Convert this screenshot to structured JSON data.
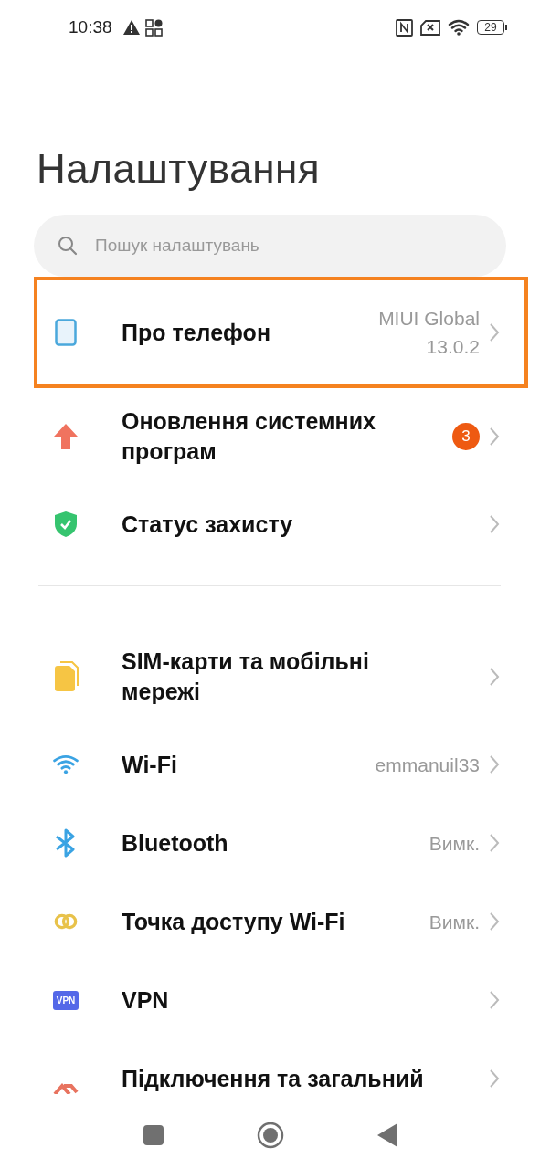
{
  "status_bar": {
    "time": "10:38",
    "battery": "29"
  },
  "title": "Налаштування",
  "search": {
    "placeholder": "Пошук налаштувань"
  },
  "sections": [
    {
      "items": [
        {
          "kind": "phone",
          "label": "Про телефон",
          "value": "MIUI Global 13.0.2",
          "highlighted": true
        },
        {
          "kind": "update",
          "label": "Оновлення системних програм",
          "badge": "3",
          "highlighted": false
        },
        {
          "kind": "shield",
          "label": "Статус захисту",
          "highlighted": false
        }
      ]
    },
    {
      "items": [
        {
          "kind": "sim",
          "label": "SIM-карти та мобільні мережі",
          "highlighted": false
        },
        {
          "kind": "wifi",
          "label": "Wi-Fi",
          "value": "emmanuil33",
          "highlighted": false
        },
        {
          "kind": "bluetooth",
          "label": "Bluetooth",
          "value": "Вимк.",
          "highlighted": false
        },
        {
          "kind": "hotspot",
          "label": "Точка доступу Wi-Fi",
          "value": "Вимк.",
          "highlighted": false
        },
        {
          "kind": "vpn",
          "icon_text": "VPN",
          "label": "VPN",
          "highlighted": false
        },
        {
          "kind": "connection",
          "label": "Підключення та загальний",
          "highlighted": false
        }
      ]
    }
  ]
}
